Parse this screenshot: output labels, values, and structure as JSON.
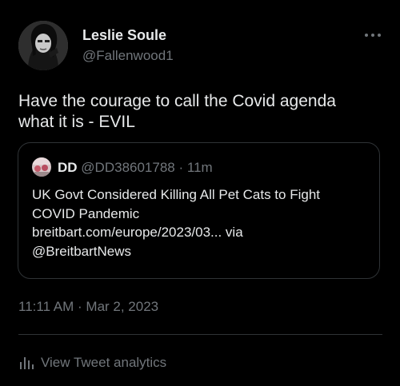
{
  "tweet": {
    "author": {
      "display_name": "Leslie Soule",
      "handle": "@Fallenwood1"
    },
    "more_icon": "more-horizontal-icon",
    "text_lines": [
      "Have the courage to call the Covid agenda",
      "what it is - EVIL"
    ],
    "quoted": {
      "display_name": "DD",
      "handle": "@DD38601788",
      "separator": "·",
      "time": "11m",
      "text_lines": [
        "UK Govt Considered Killing All Pet Cats to Fight",
        "COVID Pandemic",
        "breitbart.com/europe/2023/03... via",
        "@BreitbartNews"
      ]
    },
    "timestamp": "11:11 AM · Mar 2, 2023",
    "analytics": {
      "icon": "analytics-bar-chart-icon",
      "label": "View Tweet analytics"
    }
  },
  "colors": {
    "background": "#000000",
    "primary_text": "#e7e9ea",
    "secondary_text": "#71767b",
    "border": "#2f3336"
  }
}
